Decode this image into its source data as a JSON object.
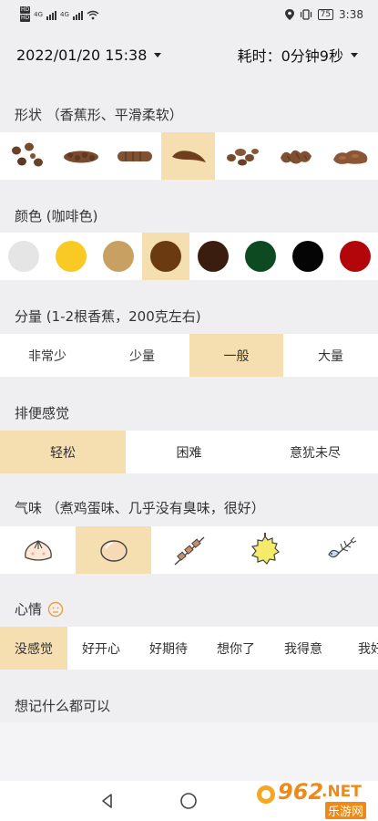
{
  "status": {
    "net1": "4G",
    "net2": "4G",
    "battery": "75",
    "time": "3:38"
  },
  "header": {
    "date": "2022/01/20 15:38",
    "duration": "耗时：0分钟9秒"
  },
  "shape": {
    "title": "形状 （香蕉形、平滑柔软）",
    "selected_index": 3,
    "items": [
      "lumps-icon",
      "sausage-cracked-icon",
      "sausage-segmented-icon",
      "banana-smooth-icon",
      "soft-blobs-icon",
      "fluffy-pieces-icon",
      "watery-icon"
    ]
  },
  "color": {
    "title": "颜色 (咖啡色)",
    "selected_index": 3,
    "swatches": [
      "#e5e5e5",
      "#f9c924",
      "#c8a062",
      "#6b3a10",
      "#3b1d0f",
      "#0d4a22",
      "#050505",
      "#b3060a"
    ]
  },
  "amount": {
    "title": "分量 (1-2根香蕉，200克左右)",
    "selected_index": 2,
    "options": [
      "非常少",
      "少量",
      "一般",
      "大量"
    ]
  },
  "feeling": {
    "title": "排便感觉",
    "selected_index": 0,
    "options": [
      "轻松",
      "困难",
      "意犹未尽"
    ]
  },
  "smell": {
    "title": "气味 （煮鸡蛋味、几乎没有臭味，很好）",
    "selected_index": 1,
    "items": [
      "bun-icon",
      "egg-icon",
      "skewer-icon",
      "durian-icon",
      "fishbone-icon"
    ]
  },
  "mood": {
    "title": "心情",
    "selected_index": 0,
    "options": [
      "没感觉",
      "好开心",
      "好期待",
      "想你了",
      "我得意",
      "我好"
    ]
  },
  "note": {
    "title": "想记什么都可以"
  },
  "watermark": {
    "number": "962",
    "suffix": ".NET",
    "site": "乐游网"
  }
}
